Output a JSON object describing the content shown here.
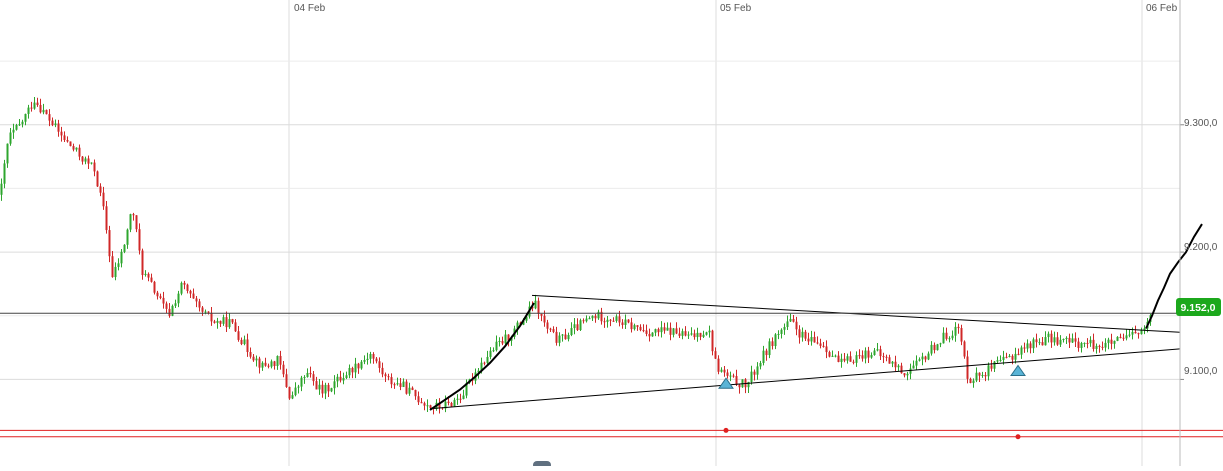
{
  "chart_data": {
    "type": "candlestick",
    "x_ticks": [
      "04 Feb",
      "05 Feb",
      "06 Feb"
    ],
    "y_ticks": [
      "9.300,0",
      "9.200,0",
      "9.100,0"
    ],
    "y_tick_values": [
      9300,
      9200,
      9100
    ],
    "ylim": [
      9032,
      9398
    ],
    "grid": true,
    "last_price": 9152,
    "last_price_label": "9.152,0",
    "price_series": [
      [
        0,
        9245
      ],
      [
        8,
        9290
      ],
      [
        20,
        9300
      ],
      [
        34,
        9320
      ],
      [
        48,
        9305
      ],
      [
        62,
        9290
      ],
      [
        80,
        9275
      ],
      [
        94,
        9265
      ],
      [
        104,
        9230
      ],
      [
        112,
        9180
      ],
      [
        122,
        9200
      ],
      [
        132,
        9235
      ],
      [
        142,
        9185
      ],
      [
        154,
        9170
      ],
      [
        168,
        9150
      ],
      [
        182,
        9175
      ],
      [
        198,
        9155
      ],
      [
        214,
        9145
      ],
      [
        230,
        9145
      ],
      [
        246,
        9125
      ],
      [
        262,
        9110
      ],
      [
        278,
        9115
      ],
      [
        290,
        9085
      ],
      [
        306,
        9105
      ],
      [
        322,
        9090
      ],
      [
        338,
        9100
      ],
      [
        354,
        9110
      ],
      [
        370,
        9120
      ],
      [
        386,
        9100
      ],
      [
        402,
        9095
      ],
      [
        418,
        9085
      ],
      [
        432,
        9078
      ],
      [
        448,
        9080
      ],
      [
        462,
        9088
      ],
      [
        478,
        9110
      ],
      [
        494,
        9125
      ],
      [
        510,
        9135
      ],
      [
        526,
        9150
      ],
      [
        534,
        9160
      ],
      [
        546,
        9140
      ],
      [
        558,
        9130
      ],
      [
        574,
        9140
      ],
      [
        594,
        9150
      ],
      [
        612,
        9148
      ],
      [
        630,
        9142
      ],
      [
        650,
        9137
      ],
      [
        670,
        9138
      ],
      [
        690,
        9133
      ],
      [
        708,
        9140
      ],
      [
        716,
        9110
      ],
      [
        730,
        9100
      ],
      [
        746,
        9095
      ],
      [
        760,
        9115
      ],
      [
        776,
        9135
      ],
      [
        790,
        9145
      ],
      [
        806,
        9130
      ],
      [
        822,
        9128
      ],
      [
        840,
        9112
      ],
      [
        856,
        9118
      ],
      [
        872,
        9122
      ],
      [
        888,
        9115
      ],
      [
        904,
        9105
      ],
      [
        918,
        9112
      ],
      [
        932,
        9125
      ],
      [
        946,
        9135
      ],
      [
        958,
        9140
      ],
      [
        968,
        9100
      ],
      [
        982,
        9105
      ],
      [
        998,
        9112
      ],
      [
        1014,
        9120
      ],
      [
        1030,
        9128
      ],
      [
        1048,
        9132
      ],
      [
        1066,
        9130
      ],
      [
        1084,
        9128
      ],
      [
        1102,
        9127
      ],
      [
        1120,
        9130
      ],
      [
        1136,
        9136
      ],
      [
        1146,
        9140
      ],
      [
        1152,
        9150
      ]
    ],
    "drawings": {
      "triangle_upper": [
        [
          532,
          9166
        ],
        [
          1180,
          9137
        ]
      ],
      "triangle_lower": [
        [
          430,
          9077
        ],
        [
          1180,
          9124
        ]
      ],
      "horizontal_level": 9152,
      "rally_curve_1": [
        [
          430,
          9076
        ],
        [
          445,
          9084
        ],
        [
          460,
          9092
        ],
        [
          475,
          9102
        ],
        [
          490,
          9113
        ],
        [
          505,
          9126
        ],
        [
          520,
          9142
        ],
        [
          534,
          9160
        ]
      ],
      "rally_curve_2": [
        [
          1146,
          9140
        ],
        [
          1152,
          9150
        ],
        [
          1158,
          9162
        ],
        [
          1164,
          9172
        ],
        [
          1170,
          9183
        ],
        [
          1178,
          9192
        ],
        [
          1186,
          9200
        ],
        [
          1194,
          9212
        ],
        [
          1202,
          9222
        ]
      ],
      "support_markers": [
        [
          726,
          9097
        ],
        [
          1018,
          9107
        ]
      ]
    },
    "red_lines": [
      {
        "y": 9060,
        "from_x": 0,
        "dot_x": 726
      },
      {
        "y": 9055,
        "from_x": 0,
        "dot_x": 1018
      }
    ],
    "colors": {
      "up": "#2ea62e",
      "down": "#d02828",
      "grid": "#dcdcdc",
      "line": "#000000",
      "badge": "#1ca81c",
      "marker": "#5ab4d6",
      "red_line": "#e02020"
    }
  }
}
